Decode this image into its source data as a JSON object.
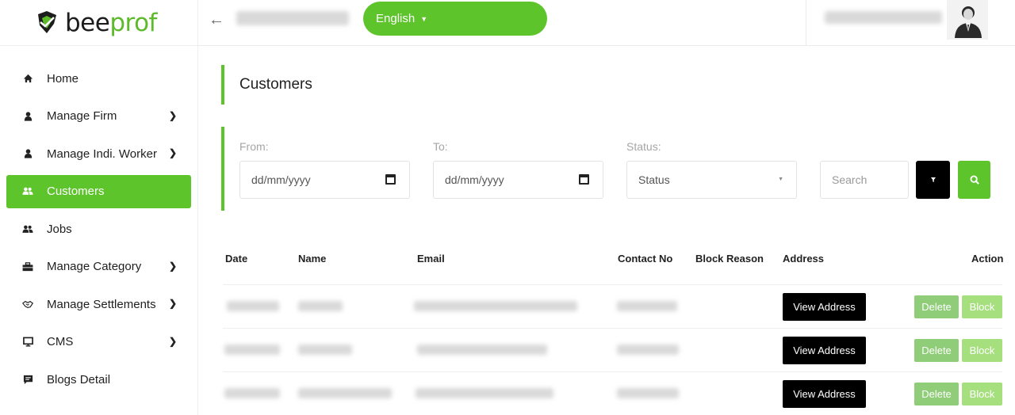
{
  "brand": {
    "name_part1": "bee",
    "name_part2": "prof",
    "accent": "#5dc42b"
  },
  "header": {
    "language": "English",
    "back_icon": "arrow-left-icon"
  },
  "sidebar": {
    "items": [
      {
        "label": "Home",
        "icon": "home-icon",
        "chevron": false,
        "active": false
      },
      {
        "label": "Manage Firm",
        "icon": "user-icon",
        "chevron": true,
        "active": false
      },
      {
        "label": "Manage Indi. Worker",
        "icon": "user-icon",
        "chevron": true,
        "active": false
      },
      {
        "label": "Customers",
        "icon": "users-icon",
        "chevron": false,
        "active": true
      },
      {
        "label": "Jobs",
        "icon": "users-icon",
        "chevron": false,
        "active": false
      },
      {
        "label": "Manage Category",
        "icon": "briefcase-icon",
        "chevron": true,
        "active": false
      },
      {
        "label": "Manage Settlements",
        "icon": "handshake-icon",
        "chevron": true,
        "active": false
      },
      {
        "label": "CMS",
        "icon": "monitor-icon",
        "chevron": true,
        "active": false
      },
      {
        "label": "Blogs Detail",
        "icon": "comment-icon",
        "chevron": false,
        "active": false
      }
    ]
  },
  "main": {
    "title": "Customers",
    "filters": {
      "from_label": "From:",
      "from_placeholder": "dd/mm/yyyy",
      "to_label": "To:",
      "to_placeholder": "dd/mm/yyyy",
      "status_label": "Status:",
      "status_value": "Status",
      "search_placeholder": "Search"
    },
    "table": {
      "headers": [
        "Date",
        "Name",
        "Email",
        "Contact No",
        "Block Reason",
        "Address",
        "Action"
      ],
      "rows": [
        {
          "view_label": "View Address",
          "delete_label": "Delete",
          "block_label": "Block"
        },
        {
          "view_label": "View Address",
          "delete_label": "Delete",
          "block_label": "Block"
        },
        {
          "view_label": "View Address",
          "delete_label": "Delete",
          "block_label": "Block"
        }
      ]
    }
  }
}
